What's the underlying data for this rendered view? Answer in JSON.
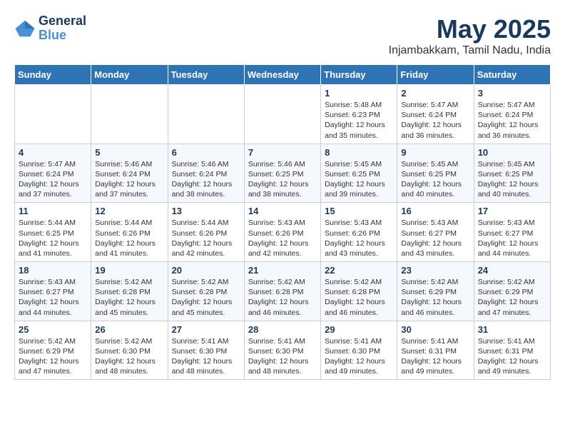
{
  "header": {
    "logo_line1": "General",
    "logo_line2": "Blue",
    "month": "May 2025",
    "location": "Injambakkam, Tamil Nadu, India"
  },
  "weekdays": [
    "Sunday",
    "Monday",
    "Tuesday",
    "Wednesday",
    "Thursday",
    "Friday",
    "Saturday"
  ],
  "weeks": [
    [
      {
        "day": "",
        "info": ""
      },
      {
        "day": "",
        "info": ""
      },
      {
        "day": "",
        "info": ""
      },
      {
        "day": "",
        "info": ""
      },
      {
        "day": "1",
        "info": "Sunrise: 5:48 AM\nSunset: 6:23 PM\nDaylight: 12 hours\nand 35 minutes."
      },
      {
        "day": "2",
        "info": "Sunrise: 5:47 AM\nSunset: 6:24 PM\nDaylight: 12 hours\nand 36 minutes."
      },
      {
        "day": "3",
        "info": "Sunrise: 5:47 AM\nSunset: 6:24 PM\nDaylight: 12 hours\nand 36 minutes."
      }
    ],
    [
      {
        "day": "4",
        "info": "Sunrise: 5:47 AM\nSunset: 6:24 PM\nDaylight: 12 hours\nand 37 minutes."
      },
      {
        "day": "5",
        "info": "Sunrise: 5:46 AM\nSunset: 6:24 PM\nDaylight: 12 hours\nand 37 minutes."
      },
      {
        "day": "6",
        "info": "Sunrise: 5:46 AM\nSunset: 6:24 PM\nDaylight: 12 hours\nand 38 minutes."
      },
      {
        "day": "7",
        "info": "Sunrise: 5:46 AM\nSunset: 6:25 PM\nDaylight: 12 hours\nand 38 minutes."
      },
      {
        "day": "8",
        "info": "Sunrise: 5:45 AM\nSunset: 6:25 PM\nDaylight: 12 hours\nand 39 minutes."
      },
      {
        "day": "9",
        "info": "Sunrise: 5:45 AM\nSunset: 6:25 PM\nDaylight: 12 hours\nand 40 minutes."
      },
      {
        "day": "10",
        "info": "Sunrise: 5:45 AM\nSunset: 6:25 PM\nDaylight: 12 hours\nand 40 minutes."
      }
    ],
    [
      {
        "day": "11",
        "info": "Sunrise: 5:44 AM\nSunset: 6:25 PM\nDaylight: 12 hours\nand 41 minutes."
      },
      {
        "day": "12",
        "info": "Sunrise: 5:44 AM\nSunset: 6:26 PM\nDaylight: 12 hours\nand 41 minutes."
      },
      {
        "day": "13",
        "info": "Sunrise: 5:44 AM\nSunset: 6:26 PM\nDaylight: 12 hours\nand 42 minutes."
      },
      {
        "day": "14",
        "info": "Sunrise: 5:43 AM\nSunset: 6:26 PM\nDaylight: 12 hours\nand 42 minutes."
      },
      {
        "day": "15",
        "info": "Sunrise: 5:43 AM\nSunset: 6:26 PM\nDaylight: 12 hours\nand 43 minutes."
      },
      {
        "day": "16",
        "info": "Sunrise: 5:43 AM\nSunset: 6:27 PM\nDaylight: 12 hours\nand 43 minutes."
      },
      {
        "day": "17",
        "info": "Sunrise: 5:43 AM\nSunset: 6:27 PM\nDaylight: 12 hours\nand 44 minutes."
      }
    ],
    [
      {
        "day": "18",
        "info": "Sunrise: 5:43 AM\nSunset: 6:27 PM\nDaylight: 12 hours\nand 44 minutes."
      },
      {
        "day": "19",
        "info": "Sunrise: 5:42 AM\nSunset: 6:28 PM\nDaylight: 12 hours\nand 45 minutes."
      },
      {
        "day": "20",
        "info": "Sunrise: 5:42 AM\nSunset: 6:28 PM\nDaylight: 12 hours\nand 45 minutes."
      },
      {
        "day": "21",
        "info": "Sunrise: 5:42 AM\nSunset: 6:28 PM\nDaylight: 12 hours\nand 46 minutes."
      },
      {
        "day": "22",
        "info": "Sunrise: 5:42 AM\nSunset: 6:28 PM\nDaylight: 12 hours\nand 46 minutes."
      },
      {
        "day": "23",
        "info": "Sunrise: 5:42 AM\nSunset: 6:29 PM\nDaylight: 12 hours\nand 46 minutes."
      },
      {
        "day": "24",
        "info": "Sunrise: 5:42 AM\nSunset: 6:29 PM\nDaylight: 12 hours\nand 47 minutes."
      }
    ],
    [
      {
        "day": "25",
        "info": "Sunrise: 5:42 AM\nSunset: 6:29 PM\nDaylight: 12 hours\nand 47 minutes."
      },
      {
        "day": "26",
        "info": "Sunrise: 5:42 AM\nSunset: 6:30 PM\nDaylight: 12 hours\nand 48 minutes."
      },
      {
        "day": "27",
        "info": "Sunrise: 5:41 AM\nSunset: 6:30 PM\nDaylight: 12 hours\nand 48 minutes."
      },
      {
        "day": "28",
        "info": "Sunrise: 5:41 AM\nSunset: 6:30 PM\nDaylight: 12 hours\nand 48 minutes."
      },
      {
        "day": "29",
        "info": "Sunrise: 5:41 AM\nSunset: 6:30 PM\nDaylight: 12 hours\nand 49 minutes."
      },
      {
        "day": "30",
        "info": "Sunrise: 5:41 AM\nSunset: 6:31 PM\nDaylight: 12 hours\nand 49 minutes."
      },
      {
        "day": "31",
        "info": "Sunrise: 5:41 AM\nSunset: 6:31 PM\nDaylight: 12 hours\nand 49 minutes."
      }
    ]
  ]
}
